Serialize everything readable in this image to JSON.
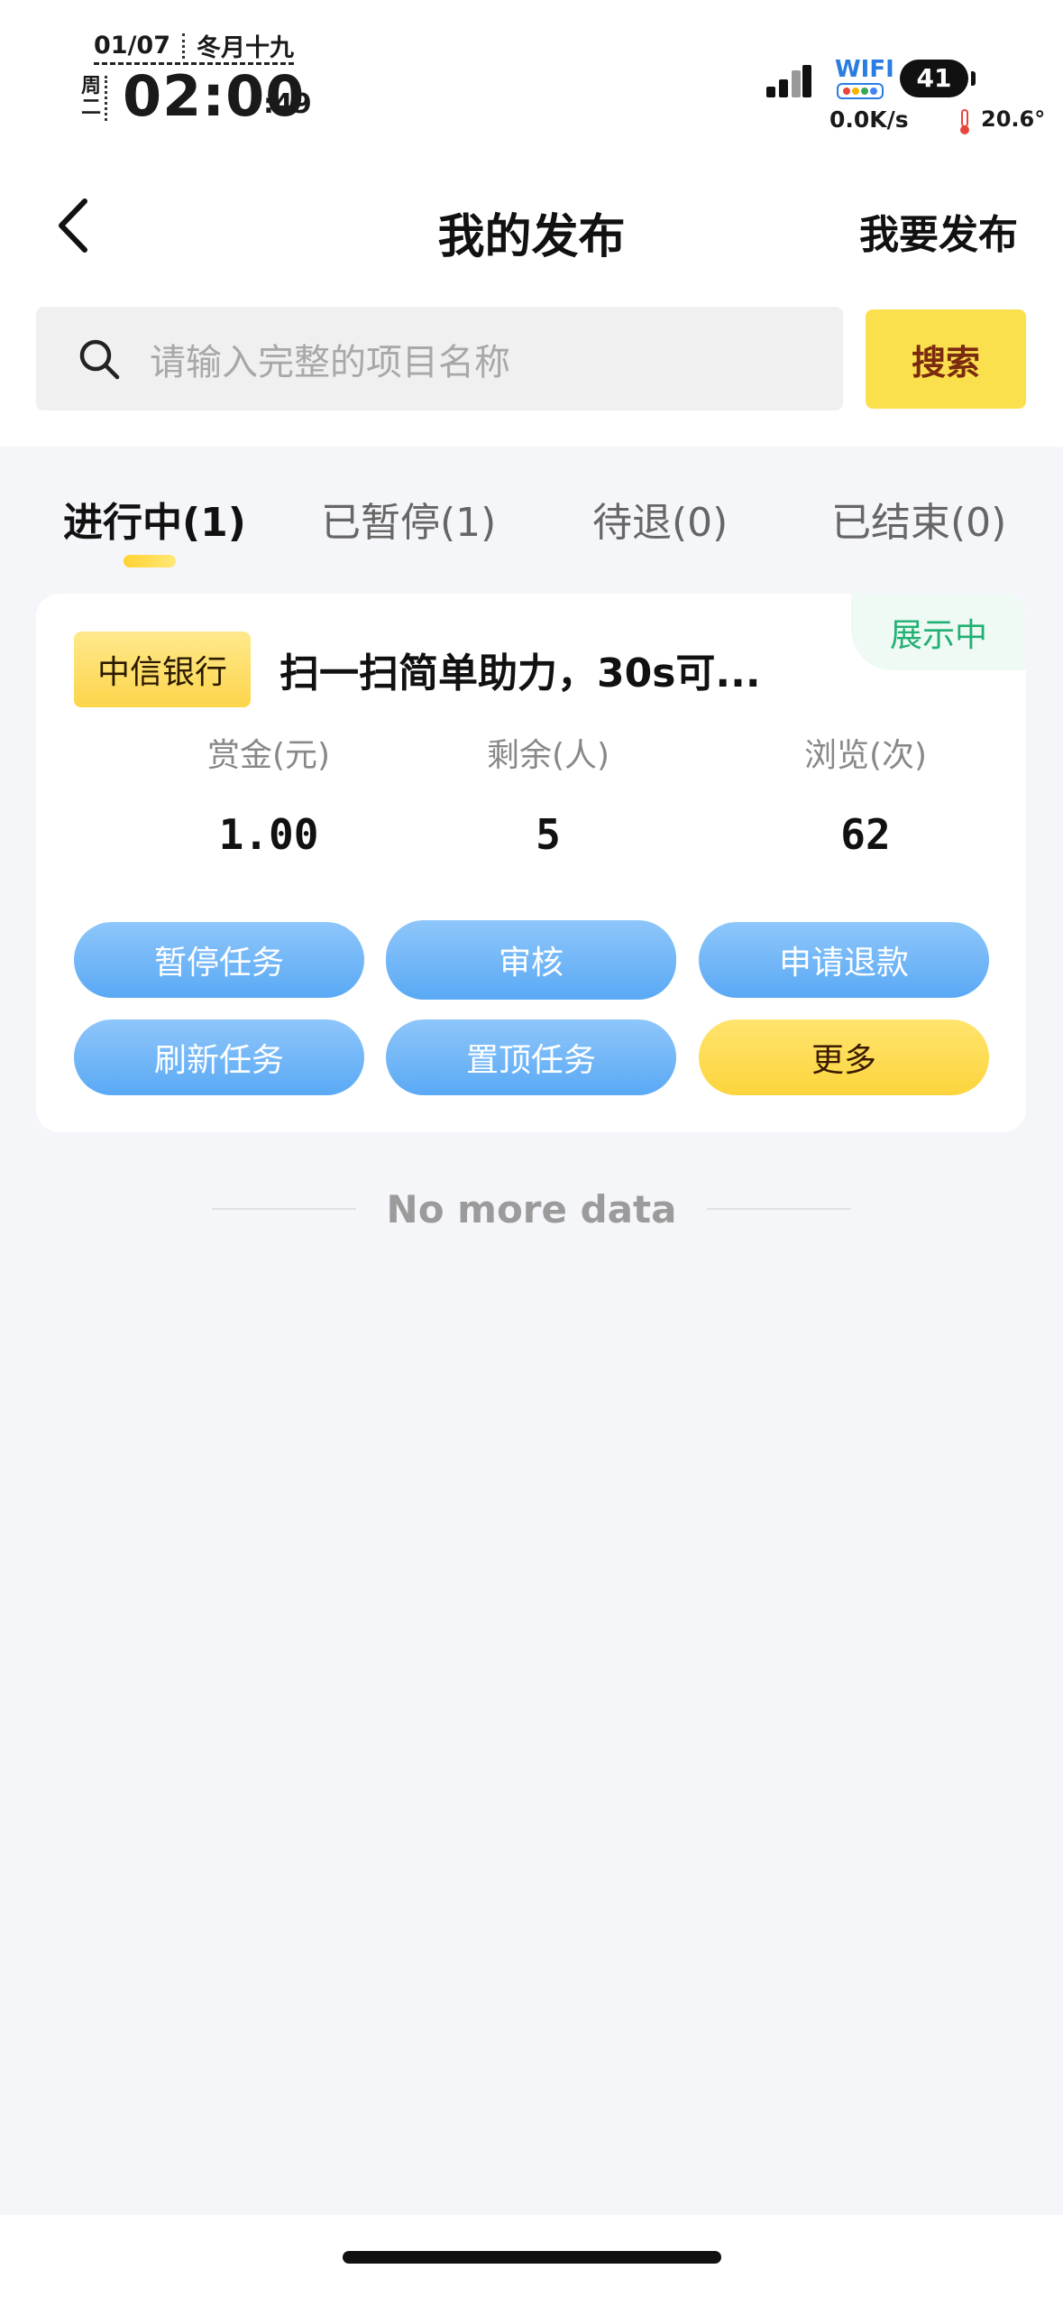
{
  "status_bar": {
    "date": "01/07",
    "lunar": "冬月十九",
    "weekday": "周二",
    "time": "02:00",
    "seconds": ":49",
    "wifi_label": "WIFI",
    "battery": "41",
    "net_speed": "0.0K/s",
    "temperature": "20.6°"
  },
  "nav": {
    "title": "我的发布",
    "action_label": "我要发布"
  },
  "search": {
    "placeholder": "请输入完整的项目名称",
    "button_label": "搜索"
  },
  "tabs": [
    {
      "label": "进行中(1)",
      "active": true
    },
    {
      "label": "已暂停(1)",
      "active": false
    },
    {
      "label": "待退(0)",
      "active": false
    },
    {
      "label": "已结束(0)",
      "active": false
    }
  ],
  "task_card": {
    "status": "展示中",
    "bank": "中信银行",
    "title": "扫一扫简单助力，30s可...",
    "stats": [
      {
        "label": "赏金(元)",
        "value": "1.00"
      },
      {
        "label": "剩余(人)",
        "value": "5"
      },
      {
        "label": "浏览(次)",
        "value": "62"
      }
    ],
    "actions": [
      {
        "label": "暂停任务"
      },
      {
        "label": "审核"
      },
      {
        "label": "申请退款"
      },
      {
        "label": "刷新任务"
      },
      {
        "label": "置顶任务"
      },
      {
        "label": "更多"
      }
    ]
  },
  "list_footer": "No more data",
  "colors": {
    "accent_yellow": "#fbe04e",
    "button_blue": "#5aa9f5",
    "status_green": "#22b074",
    "background": "#f5f6fa"
  }
}
